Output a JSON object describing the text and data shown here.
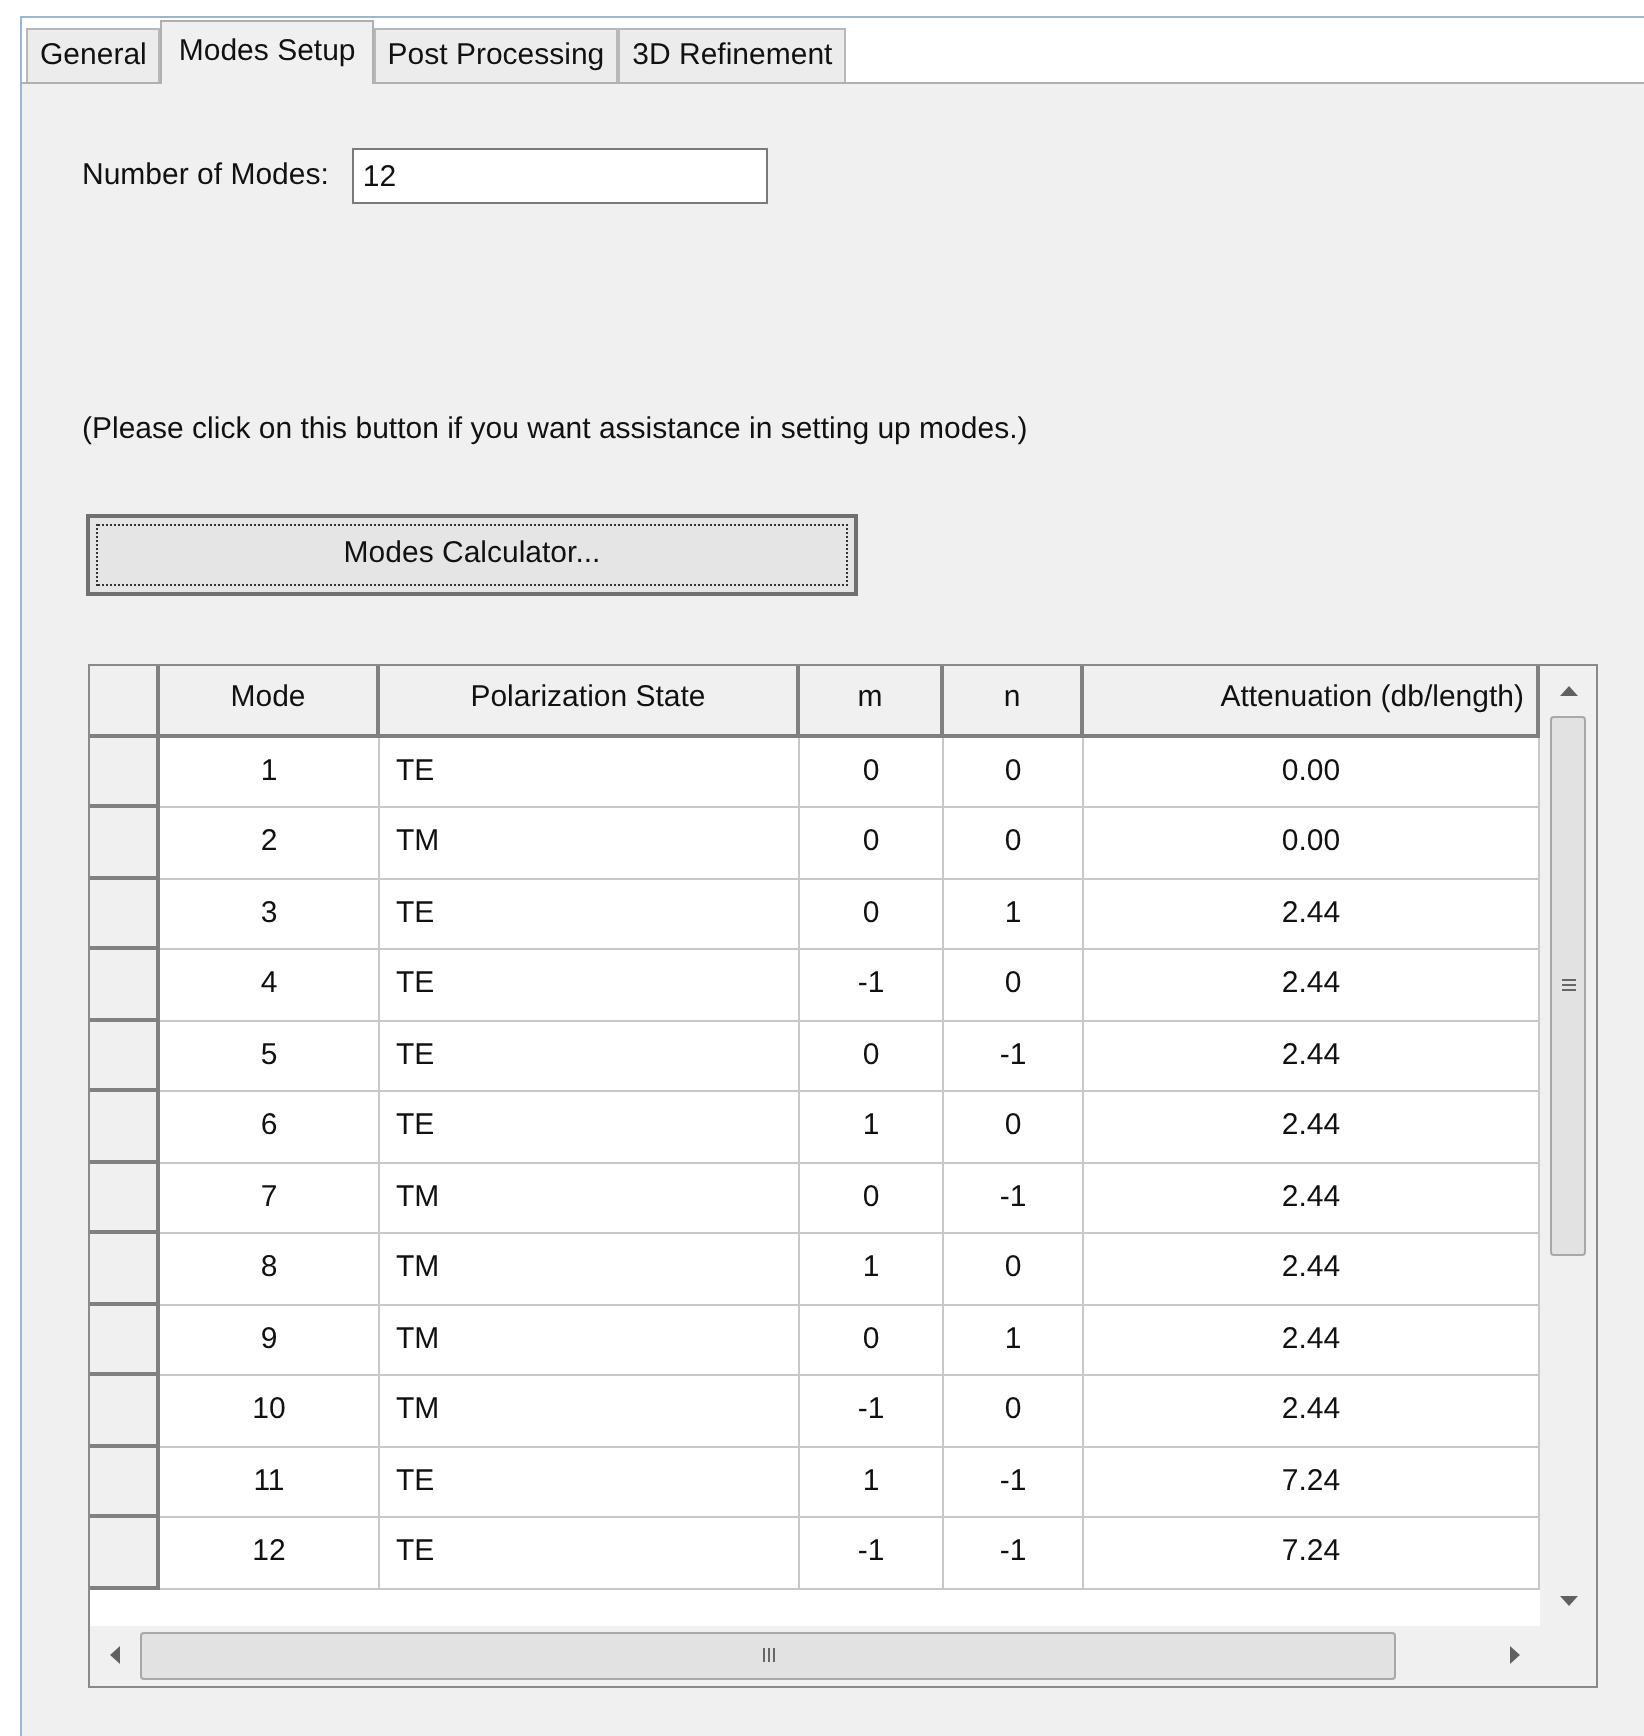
{
  "tabs": [
    {
      "label": "General",
      "selected": false
    },
    {
      "label": "Modes Setup",
      "selected": true
    },
    {
      "label": "Post Processing",
      "selected": false
    },
    {
      "label": "3D Refinement",
      "selected": false
    }
  ],
  "number_of_modes": {
    "label": "Number of Modes:",
    "value": "12"
  },
  "help_text": "(Please click on this button if you want assistance in setting up modes.)",
  "calculator_button": "Modes Calculator...",
  "table": {
    "columns": [
      "Mode",
      "Polarization State",
      "m",
      "n",
      "Attenuation (db/length)"
    ],
    "rows": [
      [
        "1",
        "TE",
        "0",
        "0",
        "0.00"
      ],
      [
        "2",
        "TM",
        "0",
        "0",
        "0.00"
      ],
      [
        "3",
        "TE",
        "0",
        "1",
        "2.44"
      ],
      [
        "4",
        "TE",
        "-1",
        "0",
        "2.44"
      ],
      [
        "5",
        "TE",
        "0",
        "-1",
        "2.44"
      ],
      [
        "6",
        "TE",
        "1",
        "0",
        "2.44"
      ],
      [
        "7",
        "TM",
        "0",
        "-1",
        "2.44"
      ],
      [
        "8",
        "TM",
        "1",
        "0",
        "2.44"
      ],
      [
        "9",
        "TM",
        "0",
        "1",
        "2.44"
      ],
      [
        "10",
        "TM",
        "-1",
        "0",
        "2.44"
      ],
      [
        "11",
        "TE",
        "1",
        "-1",
        "7.24"
      ],
      [
        "12",
        "TE",
        "-1",
        "-1",
        "7.24"
      ]
    ]
  }
}
